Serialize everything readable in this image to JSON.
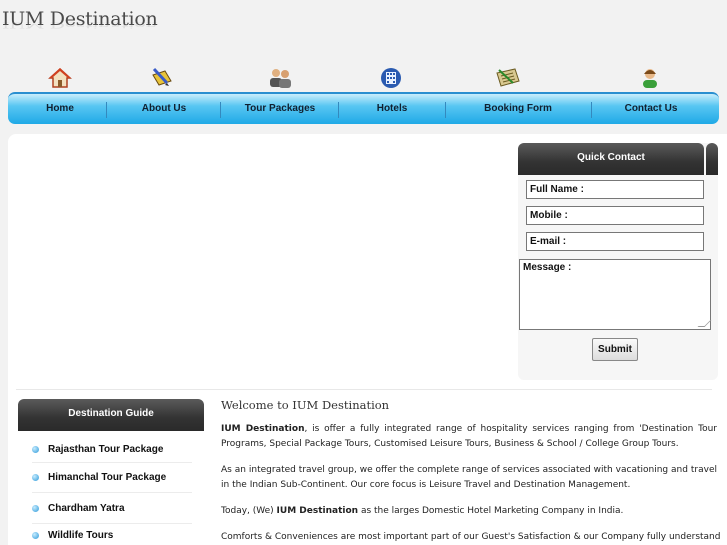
{
  "site": {
    "logo": "IUM Destination"
  },
  "nav": {
    "items": [
      {
        "label": "Home",
        "icon": "home-icon"
      },
      {
        "label": "About Us",
        "icon": "pencil-book-icon"
      },
      {
        "label": "Tour Packages",
        "icon": "people-icon"
      },
      {
        "label": "Hotels",
        "icon": "building-icon"
      },
      {
        "label": "Booking Form",
        "icon": "form-icon"
      },
      {
        "label": "Contact Us",
        "icon": "person-icon"
      }
    ]
  },
  "quick_contact": {
    "title": "Quick Contact",
    "full_name_label": "Full Name :",
    "mobile_label": "Mobile :",
    "email_label": "E-mail :",
    "message_label": "Message :",
    "submit_label": "Submit"
  },
  "destination_guide": {
    "title": "Destination Guide",
    "items": [
      "Rajasthan Tour Package",
      "Himanchal Tour Package",
      "Chardham Yatra",
      "Wildlife Tours"
    ]
  },
  "content": {
    "heading": "Welcome to IUM Destination",
    "p1_strong": "IUM Destination",
    "p1_rest": ", is offer a fully integrated range of hospitality services ranging from 'Destination Tour Programs, Special Package Tours, Customised Leisure Tours, Business & School / College Group Tours.",
    "p2": "As an integrated travel group, we offer the complete range of services associated with vacationing and travel in the Indian Sub-Continent. Our core focus is Leisure Travel and Destination Management.",
    "p3_pre": "Today, (We) ",
    "p3_strong": "IUM Destination",
    "p3_post": " as the larges Domestic Hotel Marketing Company in India.",
    "p4": "Comforts & Conveniences are most important part of our Guest's Satisfaction & our Company fully understand"
  },
  "colors": {
    "nav_light": "#c9eefc",
    "nav_dark": "#1fa9e6",
    "panel_header": "#333333",
    "bullet": "#2c98d8"
  }
}
